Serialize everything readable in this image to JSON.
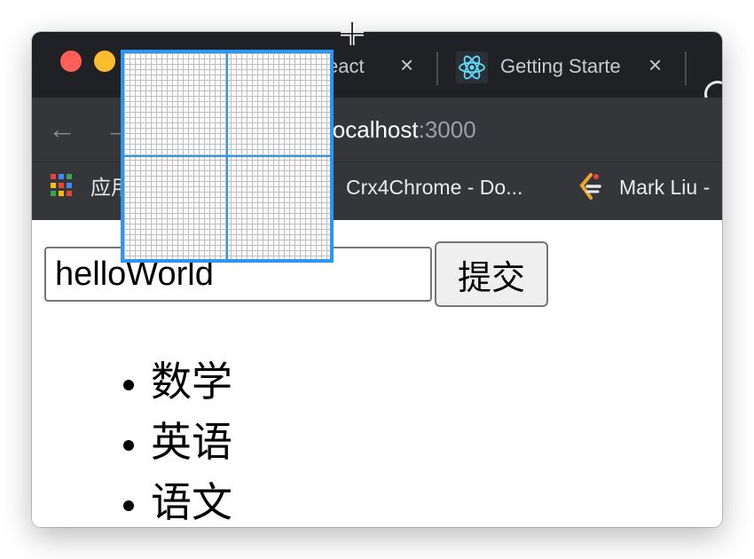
{
  "browser": {
    "tabs": [
      {
        "title": "eact",
        "close": "×"
      },
      {
        "title": "Getting Starte",
        "close": "×"
      }
    ],
    "address": {
      "host": "localhost",
      "port": ":3000"
    },
    "bookmarks": [
      {
        "label": "应用"
      },
      {
        "label": "Crx4Chrome - Do..."
      },
      {
        "label": "Mark Liu -"
      }
    ]
  },
  "page": {
    "input_value": "helloWorld",
    "submit_label": "提交",
    "subjects": [
      "数学",
      "英语",
      "语文"
    ]
  },
  "colors": {
    "tab_bar": "#202124",
    "toolbar": "#35363a",
    "overlay_accent": "#2b97f0",
    "react_icon": "#61dafb"
  }
}
